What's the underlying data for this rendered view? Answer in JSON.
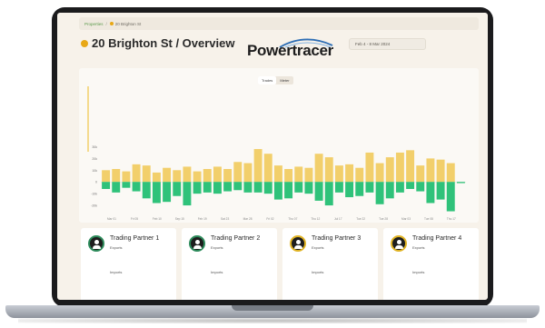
{
  "breadcrumb": {
    "root": "Properties",
    "current": "20 Brighton St"
  },
  "header": {
    "title": "20 Brighton St  /  Overview",
    "logo": "Powertracer",
    "date_range": "Feb 4 - 8 Mar 2024"
  },
  "toggle": {
    "options": [
      "Trades",
      "Meter"
    ],
    "selected": "Trades"
  },
  "colors": {
    "positive": "#f2cf6b",
    "negative": "#2fc27a",
    "accent": "#e8a816",
    "swoosh": "#2f6fb5"
  },
  "cards": [
    {
      "name": "Trading Partner 1",
      "exports": "Exports",
      "imports": "Imports",
      "icon": "user-icon"
    },
    {
      "name": "Trading Partner 2",
      "exports": "Exports",
      "imports": "Imports",
      "icon": "user-icon"
    },
    {
      "name": "Trading Partner 3",
      "exports": "Exports",
      "imports": "Imports",
      "icon": "user-icon"
    },
    {
      "name": "Trading Partner  4",
      "exports": "Exports",
      "imports": "Imports",
      "icon": "user-icon"
    }
  ],
  "chart_data": {
    "type": "bar",
    "y_ticks": [
      "30k",
      "20k",
      "10k",
      "0",
      "-10k",
      "-20k"
    ],
    "x_ticks": [
      "Mar 01",
      "Fri 05",
      "Feb 10",
      "Sep 15",
      "Feb 19",
      "Sat 23",
      "Mar 28",
      "Fri 02",
      "Thu 07",
      "Thu 12",
      "Jul 17",
      "Tue 22",
      "Tue 28",
      "Mar 03",
      "Tue 08",
      "Thu 17"
    ],
    "ylim": [
      -30,
      35
    ],
    "series": [
      {
        "values": [
          10,
          11,
          9,
          15,
          14,
          8,
          12,
          10,
          13,
          9,
          11,
          13,
          11,
          17,
          16,
          28,
          24,
          14,
          11,
          13,
          12,
          24,
          21,
          14,
          15,
          12,
          25,
          16,
          21,
          25,
          27,
          14,
          20,
          19,
          16,
          0
        ]
      },
      {
        "values": [
          -6,
          -9,
          -5,
          -8,
          -14,
          -18,
          -17,
          -12,
          -20,
          -10,
          -9,
          -10,
          -8,
          -7,
          -9,
          -9,
          -10,
          -15,
          -14,
          -9,
          -10,
          -16,
          -20,
          -9,
          -13,
          -12,
          -9,
          -19,
          -14,
          -9,
          -6,
          -8,
          -18,
          -15,
          -25,
          -1
        ]
      }
    ]
  }
}
